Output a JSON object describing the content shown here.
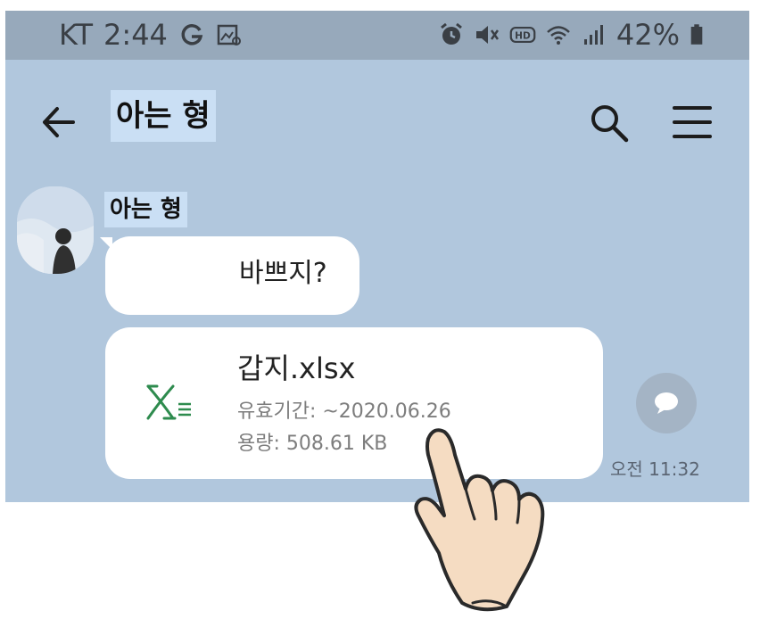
{
  "status_bar": {
    "carrier": "KT",
    "time": "2:44",
    "battery": "42%",
    "icons": [
      "g-icon",
      "gallery-icon",
      "alarm-icon",
      "mute-icon",
      "hd-icon",
      "wifi-icon",
      "signal-icon",
      "battery-icon"
    ]
  },
  "header": {
    "title": "아는 형",
    "icons": [
      "back-arrow-icon",
      "search-icon",
      "menu-icon"
    ]
  },
  "message_group": {
    "sender_name": "아는 형",
    "avatar_icon": "avatar-photo",
    "messages": [
      {
        "type": "text",
        "text": "바쁘지?"
      },
      {
        "type": "file",
        "file_name": "갑지.xlsx",
        "expiry": "유효기간: ~2020.06.26",
        "size": "용량: 508.61 KB",
        "icon": "excel-icon"
      }
    ],
    "timestamp": "오전 11:32",
    "share_icon": "share-chat-icon"
  },
  "overlay": {
    "pointer_icon": "pointing-hand-icon"
  },
  "colors": {
    "chat_background": "#b1c7dd",
    "status_bar": "#97a9bb",
    "bubble": "#ffffff",
    "excel_green": "#2e8b4e",
    "highlight": "#cadff4"
  }
}
